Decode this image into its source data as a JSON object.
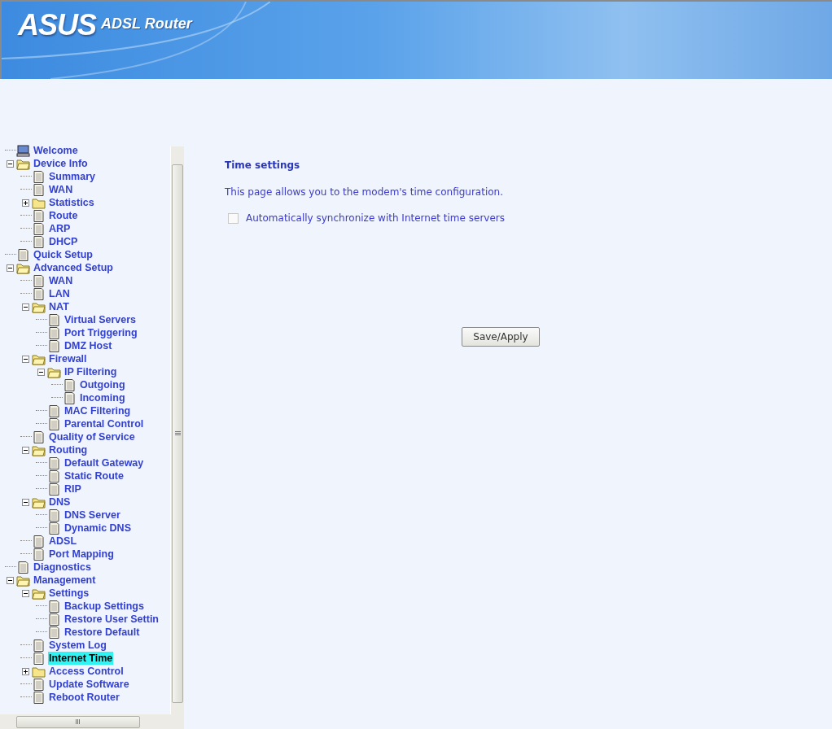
{
  "header": {
    "logo": "ASUS",
    "product": "ADSL Router"
  },
  "tree": [
    {
      "label": "Welcome",
      "kind": "computer",
      "selected": false
    },
    {
      "label": "Device Info",
      "kind": "folder",
      "expanded": true,
      "selected": false,
      "children": [
        {
          "label": "Summary",
          "kind": "page",
          "selected": false
        },
        {
          "label": "WAN",
          "kind": "page",
          "selected": false
        },
        {
          "label": "Statistics",
          "kind": "folder",
          "expanded": false,
          "selected": false
        },
        {
          "label": "Route",
          "kind": "page",
          "selected": false
        },
        {
          "label": "ARP",
          "kind": "page",
          "selected": false
        },
        {
          "label": "DHCP",
          "kind": "page",
          "selected": false
        }
      ]
    },
    {
      "label": "Quick Setup",
      "kind": "page",
      "selected": false
    },
    {
      "label": "Advanced Setup",
      "kind": "folder",
      "expanded": true,
      "selected": false,
      "children": [
        {
          "label": "WAN",
          "kind": "page",
          "selected": false
        },
        {
          "label": "LAN",
          "kind": "page",
          "selected": false
        },
        {
          "label": "NAT",
          "kind": "folder",
          "expanded": true,
          "selected": false,
          "children": [
            {
              "label": "Virtual Servers",
              "kind": "page",
              "selected": false
            },
            {
              "label": "Port Triggering",
              "kind": "page",
              "selected": false
            },
            {
              "label": "DMZ Host",
              "kind": "page",
              "selected": false
            }
          ]
        },
        {
          "label": "Firewall",
          "kind": "folder",
          "expanded": true,
          "selected": false,
          "children": [
            {
              "label": "IP Filtering",
              "kind": "folder",
              "expanded": true,
              "selected": false,
              "children": [
                {
                  "label": "Outgoing",
                  "kind": "page",
                  "selected": false
                },
                {
                  "label": "Incoming",
                  "kind": "page",
                  "selected": false
                }
              ]
            },
            {
              "label": "MAC Filtering",
              "kind": "page",
              "selected": false
            },
            {
              "label": "Parental Control",
              "kind": "page",
              "selected": false
            }
          ]
        },
        {
          "label": "Quality of Service",
          "kind": "page",
          "selected": false
        },
        {
          "label": "Routing",
          "kind": "folder",
          "expanded": true,
          "selected": false,
          "children": [
            {
              "label": "Default Gateway",
              "kind": "page",
              "selected": false
            },
            {
              "label": "Static Route",
              "kind": "page",
              "selected": false
            },
            {
              "label": "RIP",
              "kind": "page",
              "selected": false
            }
          ]
        },
        {
          "label": "DNS",
          "kind": "folder",
          "expanded": true,
          "selected": false,
          "children": [
            {
              "label": "DNS Server",
              "kind": "page",
              "selected": false
            },
            {
              "label": "Dynamic DNS",
              "kind": "page",
              "selected": false
            }
          ]
        },
        {
          "label": "ADSL",
          "kind": "page",
          "selected": false
        },
        {
          "label": "Port Mapping",
          "kind": "page",
          "selected": false
        }
      ]
    },
    {
      "label": "Diagnostics",
      "kind": "page",
      "selected": false
    },
    {
      "label": "Management",
      "kind": "folder",
      "expanded": true,
      "selected": false,
      "children": [
        {
          "label": "Settings",
          "kind": "folder",
          "expanded": true,
          "selected": false,
          "children": [
            {
              "label": "Backup Settings",
              "kind": "page",
              "selected": false
            },
            {
              "label": "Restore User Settin",
              "kind": "page",
              "selected": false
            },
            {
              "label": "Restore Default",
              "kind": "page",
              "selected": false
            }
          ]
        },
        {
          "label": "System Log",
          "kind": "page",
          "selected": false
        },
        {
          "label": "Internet Time",
          "kind": "page",
          "selected": true
        },
        {
          "label": "Access Control",
          "kind": "folder",
          "expanded": false,
          "selected": false
        },
        {
          "label": "Update Software",
          "kind": "page",
          "selected": false
        },
        {
          "label": "Reboot Router",
          "kind": "page",
          "selected": false
        }
      ]
    }
  ],
  "content": {
    "title": "Time settings",
    "description": "This page allows you to the modem's time configuration.",
    "sync": {
      "label": "Automatically synchronize with Internet time servers",
      "checked": false
    },
    "button": "Save/Apply"
  }
}
